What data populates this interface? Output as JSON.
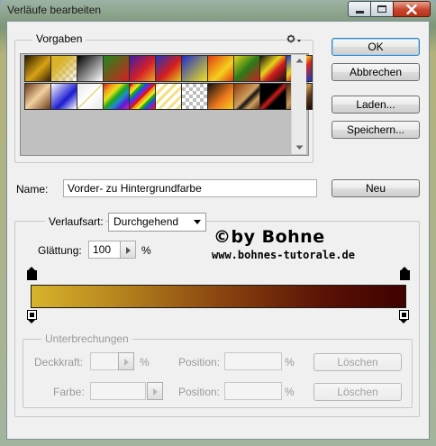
{
  "window": {
    "title": "Verläufe bearbeiten"
  },
  "presets": {
    "label": "Vorgaben",
    "swatches": [
      {
        "bg": "linear-gradient(135deg,#2a1a00,#d8a316 55%,#3a2000)"
      },
      {
        "bg": "linear-gradient(135deg,#d9b32a 0%,#d9b32a 30%,transparent 100%),repeating-conic-gradient(#cfcfcf 0% 25%,#ffffff 0% 50%) 0 0/8px 8px"
      },
      {
        "bg": "linear-gradient(135deg,#000,#fff)"
      },
      {
        "bg": "linear-gradient(135deg,#1c8a1c,#d41f1f)"
      },
      {
        "bg": "linear-gradient(135deg,#3a1fa8,#d21e2a 55%,#f0a31c)"
      },
      {
        "bg": "linear-gradient(135deg,#1d37c2,#d51d1d 55%,#e8c91c)"
      },
      {
        "bg": "linear-gradient(135deg,#1c2fc8,#f2e21d)"
      },
      {
        "bg": "linear-gradient(135deg,#e23a11,#f5d11c 60%,#e23a11)"
      },
      {
        "bg": "linear-gradient(135deg,#e2d41c,#2a7a1a 50%,#d21c1c)"
      },
      {
        "bg": "linear-gradient(135deg,#111,#e8d21c 40%,#d21c1c 60%,#111)"
      },
      {
        "bg": "linear-gradient(135deg,#1838c8,#f0d21c 40%,#d22a1c 60%,#1838c8)"
      },
      {
        "bg": "linear-gradient(135deg,#6a3a1a,#f2cfa0 50%,#6a3a1a)"
      },
      {
        "bg": "linear-gradient(135deg,#ffffff,#1c1cd0 60%,#ffffff)"
      },
      {
        "bg": "linear-gradient(135deg,#e8e8e8 0%,#ffffff 48%,#d8b31c 50%,#ffffff 52%,#e8e8e8 100%)"
      },
      {
        "bg": "linear-gradient(135deg,#d21c1c,#f2a01c 20%,#e8e01c 35%,#1ca81c 50%,#1c8ad2 65%,#5a1cd2 80%,#d21cd2)"
      },
      {
        "bg": "repeating-linear-gradient(135deg,#d21c1c 0 3px,#f2a01c 3px 6px,#e8e01c 6px 9px,#1ca81c 9px 12px,#1c5ad2 12px 15px,#8a1cd2 15px 18px)"
      },
      {
        "bg": "repeating-linear-gradient(135deg,#f2e080 0 3px,#ffffff 3px 7px),repeating-conic-gradient(#cfcfcf 0% 25%,#ffffff 0% 50%) 0 0/8px 8px"
      },
      {
        "bg": "repeating-conic-gradient(#bdbdbd 0% 25%,#ffffff 0% 50%) 0 0/8px 8px"
      },
      {
        "bg": "linear-gradient(135deg,#111 0%,#f07a1c 60%,#f2d01c 100%)"
      },
      {
        "bg": "linear-gradient(135deg,#8a3a0a,#d0a060 50%,#111 60%,#d0a060 75%,#5a2a0a)"
      },
      {
        "bg": "linear-gradient(135deg,#000,#000 40%,#d01c1c 52%,#000 64%,#000)"
      },
      {
        "bg": "linear-gradient(135deg,#4a2a0a,#c89a5a 45%,#5a3a1a 70%,#1a0a00)"
      }
    ]
  },
  "buttons": {
    "ok": "OK",
    "cancel": "Abbrechen",
    "load": "Laden...",
    "save": "Speichern...",
    "new": "Neu"
  },
  "name": {
    "label": "Name:",
    "value": "Vorder- zu Hintergrundfarbe"
  },
  "gradient_type": {
    "label": "Verlaufsart:",
    "value": "Durchgehend"
  },
  "smoothness": {
    "label": "Glättung:",
    "value": "100",
    "unit": "%"
  },
  "watermark": {
    "line1": "©by Bohne",
    "line2": "www.bohnes-tutorale.de"
  },
  "colors": {
    "start": "#d7b32c",
    "end": "#3e0200"
  },
  "stops": {
    "title": "Unterbrechungen",
    "opacity_label": "Deckkraft:",
    "opacity_unit": "%",
    "position_label": "Position:",
    "position_unit": "%",
    "delete_label": "Löschen",
    "color_label": "Farbe:"
  }
}
